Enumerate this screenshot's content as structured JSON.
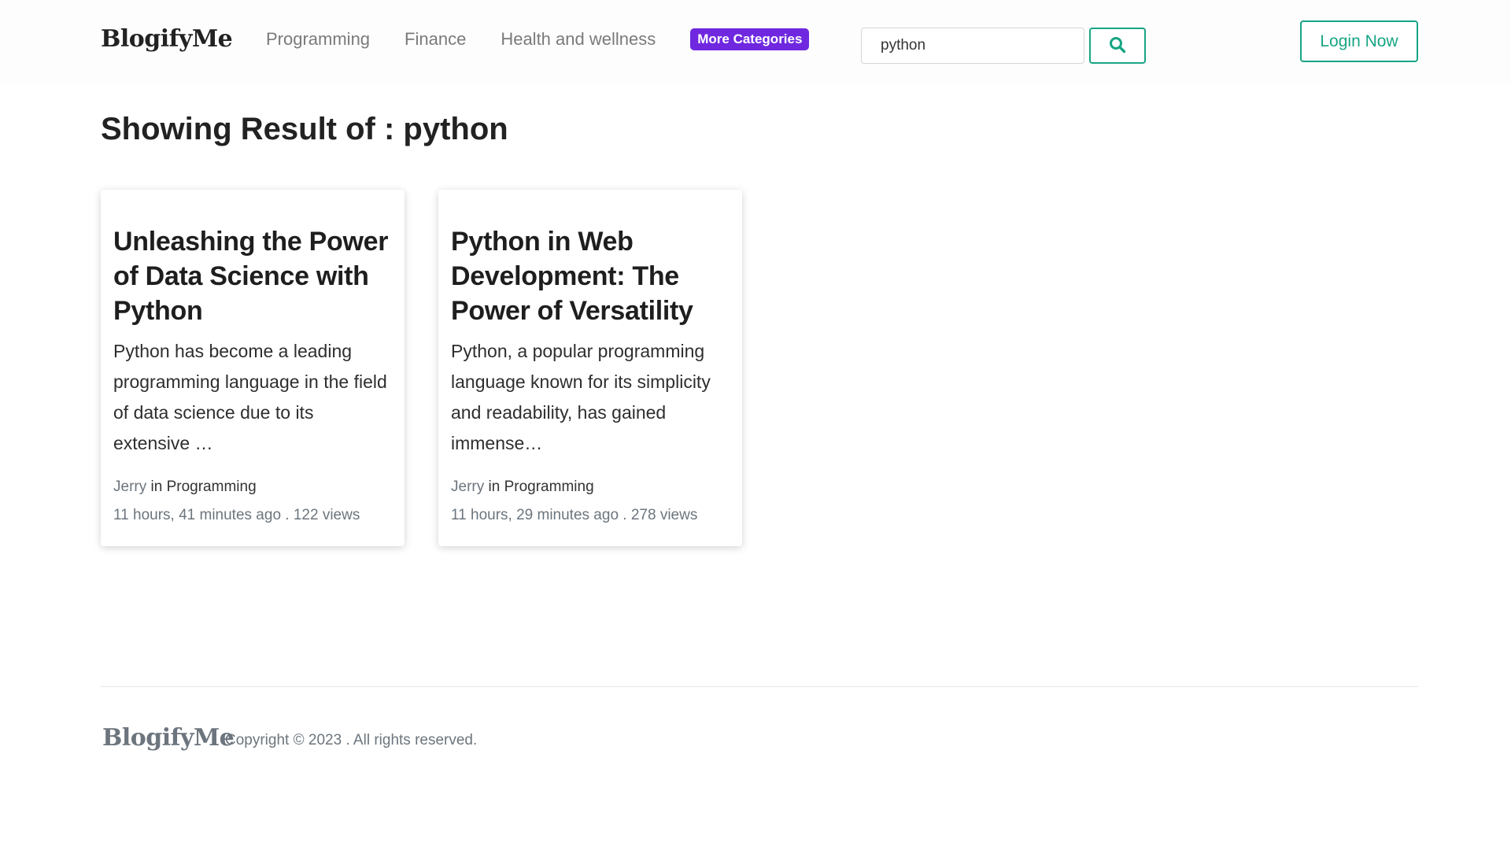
{
  "header": {
    "brand": "BlogifyMe",
    "nav": [
      "Programming",
      "Finance",
      "Health and wellness"
    ],
    "more_categories": "More Categories",
    "search": {
      "value": "python",
      "placeholder": ""
    },
    "login": "Login Now"
  },
  "results": {
    "prefix": "Showing Result of : ",
    "query": "python"
  },
  "cards": [
    {
      "title": "Unleashing the Power of Data Science with Python",
      "excerpt": "Python has become a leading programming language in the field of data science due to its extensive …",
      "author": "Jerry",
      "in": " in ",
      "category": "Programming",
      "time_views": "11 hours, 41 minutes ago . 122 views"
    },
    {
      "title": "Python in Web Development: The Power of Versatility",
      "excerpt": "Python, a popular programming language known for its simplicity and readability, has gained immense…",
      "author": "Jerry",
      "in": " in ",
      "category": "Programming",
      "time_views": "11 hours, 29 minutes ago . 278 views"
    }
  ],
  "footer": {
    "brand": "BlogifyMe",
    "copyright": "Copyright © 2023 . All rights reserved."
  },
  "colors": {
    "accent": "#18a584",
    "more_categories_bg": "#6f28e0"
  },
  "icons": {
    "search_button": "search-icon"
  }
}
